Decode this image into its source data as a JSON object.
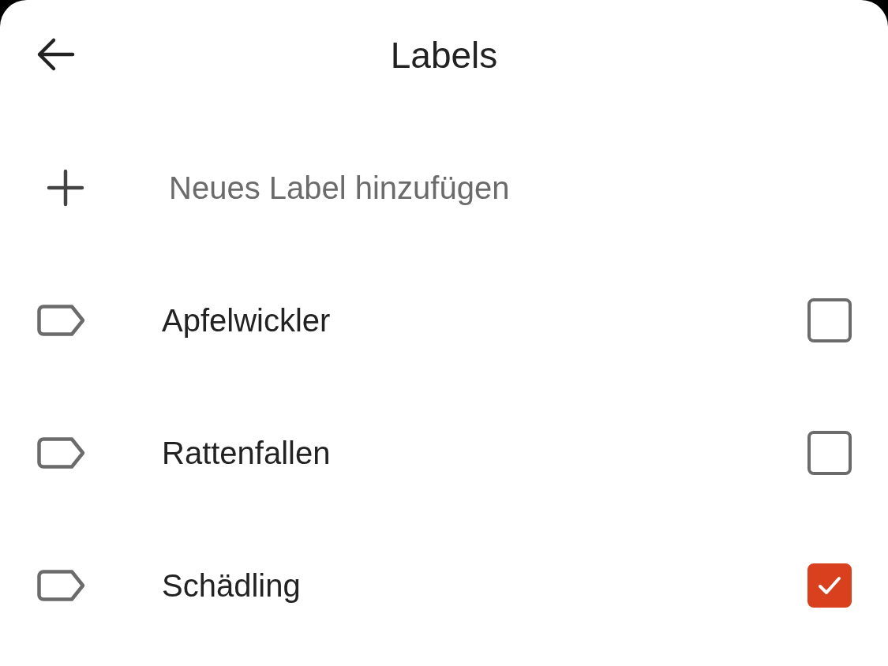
{
  "title": "Labels",
  "new_label": {
    "placeholder": "Neues Label hinzufügen"
  },
  "labels": [
    {
      "name": "Apfelwickler",
      "checked": false
    },
    {
      "name": "Rattenfallen",
      "checked": false
    },
    {
      "name": "Schädling",
      "checked": true
    }
  ]
}
